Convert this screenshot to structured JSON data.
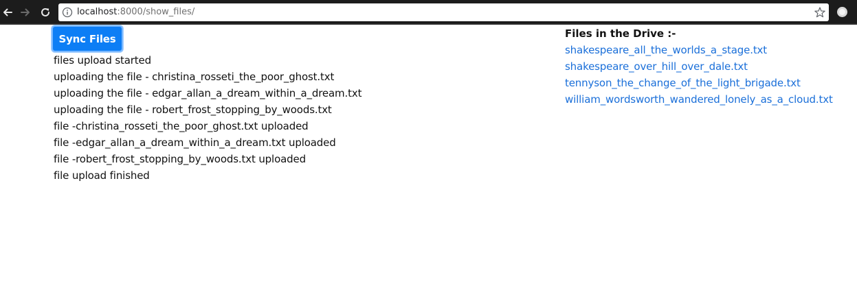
{
  "browser": {
    "url_host": "localhost",
    "url_path": ":8000/show_files/",
    "icons": {
      "back": "back-arrow-icon",
      "forward": "forward-arrow-icon",
      "reload": "reload-icon",
      "info": "info-icon",
      "bookmark": "star-icon",
      "extension": "extension-icon"
    }
  },
  "sync": {
    "button_label": "Sync Files"
  },
  "log": [
    "files upload started",
    "uploading the file - christina_rosseti_the_poor_ghost.txt",
    "uploading the file - edgar_allan_a_dream_within_a_dream.txt",
    "uploading the file - robert_frost_stopping_by_woods.txt",
    "file -christina_rosseti_the_poor_ghost.txt uploaded",
    "file -edgar_allan_a_dream_within_a_dream.txt uploaded",
    "file -robert_frost_stopping_by_woods.txt uploaded",
    "file upload finished"
  ],
  "drive": {
    "heading": "Files in the Drive :-",
    "files": [
      "shakespeare_all_the_worlds_a_stage.txt",
      "shakespeare_over_hill_over_dale.txt",
      "tennyson_the_change_of_the_light_brigade.txt",
      "william_wordsworth_wandered_lonely_as_a_cloud.txt"
    ]
  },
  "colors": {
    "button_bg": "#0d7ef5",
    "link": "#1a6fd9",
    "chrome_bg": "#1c1c1c"
  }
}
